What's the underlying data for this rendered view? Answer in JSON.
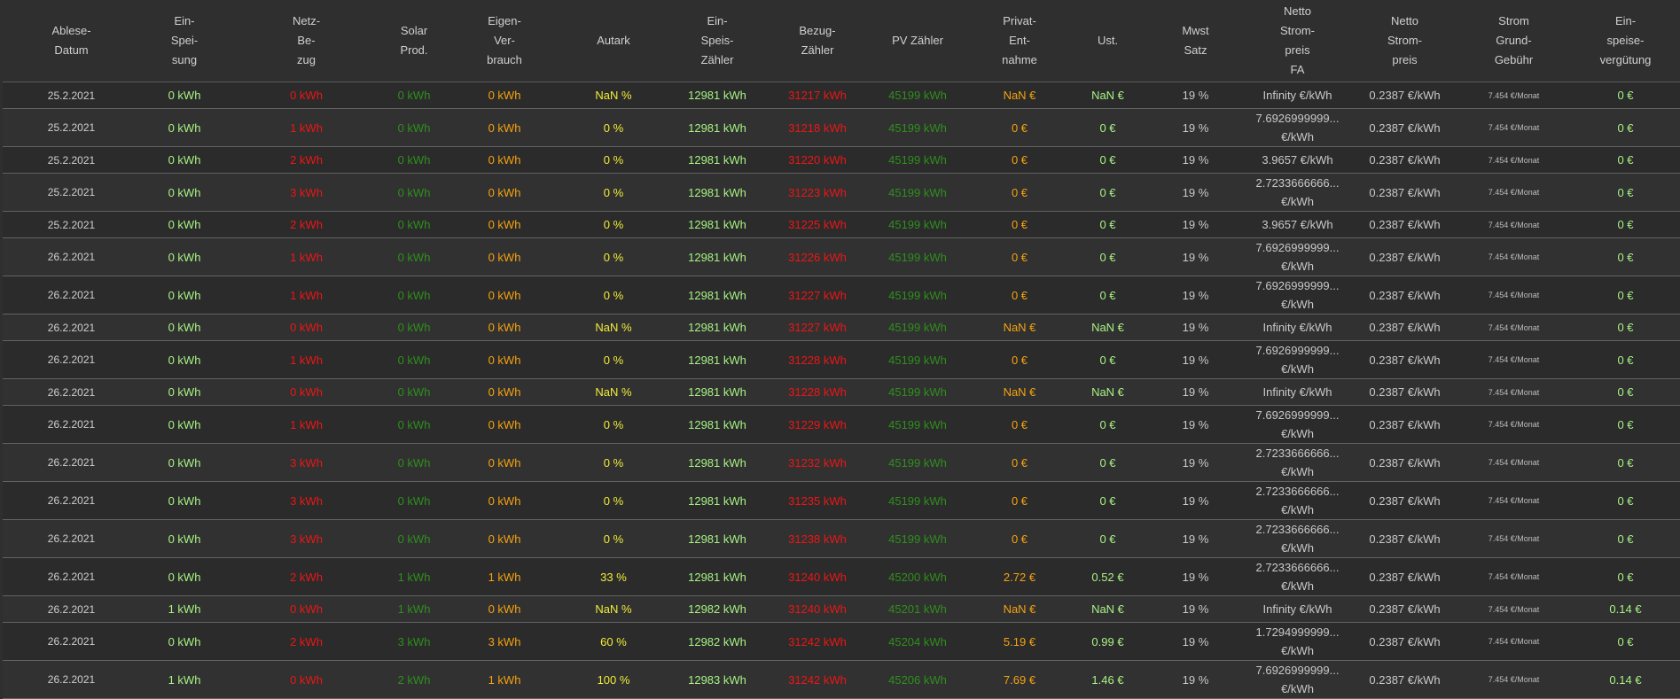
{
  "headers": [
    {
      "key": "datum",
      "label": "Ablese-\nDatum"
    },
    {
      "key": "einspeisung",
      "label": "Ein-\nSpei-\nsung"
    },
    {
      "key": "netzbezug",
      "label": "Netz-\nBe-\nzug"
    },
    {
      "key": "solar",
      "label": "Solar\nProd."
    },
    {
      "key": "eigen",
      "label": "Eigen-\nVer-\nbrauch"
    },
    {
      "key": "autark",
      "label": "Autark"
    },
    {
      "key": "einspeiszaehler",
      "label": "Ein-\nSpeis-\nZähler"
    },
    {
      "key": "bezugzaehler",
      "label": "Bezug-\nZähler"
    },
    {
      "key": "pvzaehler",
      "label": "PV Zähler"
    },
    {
      "key": "privat",
      "label": "Privat-\nEnt-\nnahme"
    },
    {
      "key": "ust",
      "label": "Ust."
    },
    {
      "key": "mwst",
      "label": "Mwst\nSatz"
    },
    {
      "key": "nettofa",
      "label": "Netto\nStrom-\npreis\nFA"
    },
    {
      "key": "netto",
      "label": "Netto\nStrom-\npreis"
    },
    {
      "key": "grund",
      "label": "Strom\nGrund-\nGebühr"
    },
    {
      "key": "verguetung",
      "label": "Ein-\nspeise-\nvergütung"
    }
  ],
  "rows": [
    {
      "datum": "25.2.2021",
      "einspeisung": "0 kWh",
      "netzbezug": "0 kWh",
      "solar": "0 kWh",
      "eigen": "0 kWh",
      "autark": "NaN %",
      "einspeiszaehler": "12981 kWh",
      "bezugzaehler": "31217 kWh",
      "pvzaehler": "45199 kWh",
      "privat": "NaN €",
      "ust": "NaN €",
      "mwst": "19 %",
      "nettofa": "Infinity €/kWh",
      "netto": "0.2387 €/kWh",
      "grund": "7.454 €/Monat",
      "verguetung": "0 €"
    },
    {
      "datum": "25.2.2021",
      "einspeisung": "0 kWh",
      "netzbezug": "1 kWh",
      "solar": "0 kWh",
      "eigen": "0 kWh",
      "autark": "0 %",
      "einspeiszaehler": "12981 kWh",
      "bezugzaehler": "31218 kWh",
      "pvzaehler": "45199 kWh",
      "privat": "0 €",
      "ust": "0 €",
      "mwst": "19 %",
      "nettofa": "7.6926999999...\n€/kWh",
      "netto": "0.2387 €/kWh",
      "grund": "7.454 €/Monat",
      "verguetung": "0 €"
    },
    {
      "datum": "25.2.2021",
      "einspeisung": "0 kWh",
      "netzbezug": "2 kWh",
      "solar": "0 kWh",
      "eigen": "0 kWh",
      "autark": "0 %",
      "einspeiszaehler": "12981 kWh",
      "bezugzaehler": "31220 kWh",
      "pvzaehler": "45199 kWh",
      "privat": "0 €",
      "ust": "0 €",
      "mwst": "19 %",
      "nettofa": "3.9657 €/kWh",
      "netto": "0.2387 €/kWh",
      "grund": "7.454 €/Monat",
      "verguetung": "0 €"
    },
    {
      "datum": "25.2.2021",
      "einspeisung": "0 kWh",
      "netzbezug": "3 kWh",
      "solar": "0 kWh",
      "eigen": "0 kWh",
      "autark": "0 %",
      "einspeiszaehler": "12981 kWh",
      "bezugzaehler": "31223 kWh",
      "pvzaehler": "45199 kWh",
      "privat": "0 €",
      "ust": "0 €",
      "mwst": "19 %",
      "nettofa": "2.7233666666...\n€/kWh",
      "netto": "0.2387 €/kWh",
      "grund": "7.454 €/Monat",
      "verguetung": "0 €"
    },
    {
      "datum": "25.2.2021",
      "einspeisung": "0 kWh",
      "netzbezug": "2 kWh",
      "solar": "0 kWh",
      "eigen": "0 kWh",
      "autark": "0 %",
      "einspeiszaehler": "12981 kWh",
      "bezugzaehler": "31225 kWh",
      "pvzaehler": "45199 kWh",
      "privat": "0 €",
      "ust": "0 €",
      "mwst": "19 %",
      "nettofa": "3.9657 €/kWh",
      "netto": "0.2387 €/kWh",
      "grund": "7.454 €/Monat",
      "verguetung": "0 €"
    },
    {
      "datum": "26.2.2021",
      "einspeisung": "0 kWh",
      "netzbezug": "1 kWh",
      "solar": "0 kWh",
      "eigen": "0 kWh",
      "autark": "0 %",
      "einspeiszaehler": "12981 kWh",
      "bezugzaehler": "31226 kWh",
      "pvzaehler": "45199 kWh",
      "privat": "0 €",
      "ust": "0 €",
      "mwst": "19 %",
      "nettofa": "7.6926999999...\n€/kWh",
      "netto": "0.2387 €/kWh",
      "grund": "7.454 €/Monat",
      "verguetung": "0 €"
    },
    {
      "datum": "26.2.2021",
      "einspeisung": "0 kWh",
      "netzbezug": "1 kWh",
      "solar": "0 kWh",
      "eigen": "0 kWh",
      "autark": "0 %",
      "einspeiszaehler": "12981 kWh",
      "bezugzaehler": "31227 kWh",
      "pvzaehler": "45199 kWh",
      "privat": "0 €",
      "ust": "0 €",
      "mwst": "19 %",
      "nettofa": "7.6926999999...\n€/kWh",
      "netto": "0.2387 €/kWh",
      "grund": "7.454 €/Monat",
      "verguetung": "0 €"
    },
    {
      "datum": "26.2.2021",
      "einspeisung": "0 kWh",
      "netzbezug": "0 kWh",
      "solar": "0 kWh",
      "eigen": "0 kWh",
      "autark": "NaN %",
      "einspeiszaehler": "12981 kWh",
      "bezugzaehler": "31227 kWh",
      "pvzaehler": "45199 kWh",
      "privat": "NaN €",
      "ust": "NaN €",
      "mwst": "19 %",
      "nettofa": "Infinity €/kWh",
      "netto": "0.2387 €/kWh",
      "grund": "7.454 €/Monat",
      "verguetung": "0 €"
    },
    {
      "datum": "26.2.2021",
      "einspeisung": "0 kWh",
      "netzbezug": "1 kWh",
      "solar": "0 kWh",
      "eigen": "0 kWh",
      "autark": "0 %",
      "einspeiszaehler": "12981 kWh",
      "bezugzaehler": "31228 kWh",
      "pvzaehler": "45199 kWh",
      "privat": "0 €",
      "ust": "0 €",
      "mwst": "19 %",
      "nettofa": "7.6926999999...\n€/kWh",
      "netto": "0.2387 €/kWh",
      "grund": "7.454 €/Monat",
      "verguetung": "0 €"
    },
    {
      "datum": "26.2.2021",
      "einspeisung": "0 kWh",
      "netzbezug": "0 kWh",
      "solar": "0 kWh",
      "eigen": "0 kWh",
      "autark": "NaN %",
      "einspeiszaehler": "12981 kWh",
      "bezugzaehler": "31228 kWh",
      "pvzaehler": "45199 kWh",
      "privat": "NaN €",
      "ust": "NaN €",
      "mwst": "19 %",
      "nettofa": "Infinity €/kWh",
      "netto": "0.2387 €/kWh",
      "grund": "7.454 €/Monat",
      "verguetung": "0 €"
    },
    {
      "datum": "26.2.2021",
      "einspeisung": "0 kWh",
      "netzbezug": "1 kWh",
      "solar": "0 kWh",
      "eigen": "0 kWh",
      "autark": "0 %",
      "einspeiszaehler": "12981 kWh",
      "bezugzaehler": "31229 kWh",
      "pvzaehler": "45199 kWh",
      "privat": "0 €",
      "ust": "0 €",
      "mwst": "19 %",
      "nettofa": "7.6926999999...\n€/kWh",
      "netto": "0.2387 €/kWh",
      "grund": "7.454 €/Monat",
      "verguetung": "0 €"
    },
    {
      "datum": "26.2.2021",
      "einspeisung": "0 kWh",
      "netzbezug": "3 kWh",
      "solar": "0 kWh",
      "eigen": "0 kWh",
      "autark": "0 %",
      "einspeiszaehler": "12981 kWh",
      "bezugzaehler": "31232 kWh",
      "pvzaehler": "45199 kWh",
      "privat": "0 €",
      "ust": "0 €",
      "mwst": "19 %",
      "nettofa": "2.7233666666...\n€/kWh",
      "netto": "0.2387 €/kWh",
      "grund": "7.454 €/Monat",
      "verguetung": "0 €"
    },
    {
      "datum": "26.2.2021",
      "einspeisung": "0 kWh",
      "netzbezug": "3 kWh",
      "solar": "0 kWh",
      "eigen": "0 kWh",
      "autark": "0 %",
      "einspeiszaehler": "12981 kWh",
      "bezugzaehler": "31235 kWh",
      "pvzaehler": "45199 kWh",
      "privat": "0 €",
      "ust": "0 €",
      "mwst": "19 %",
      "nettofa": "2.7233666666...\n€/kWh",
      "netto": "0.2387 €/kWh",
      "grund": "7.454 €/Monat",
      "verguetung": "0 €"
    },
    {
      "datum": "26.2.2021",
      "einspeisung": "0 kWh",
      "netzbezug": "3 kWh",
      "solar": "0 kWh",
      "eigen": "0 kWh",
      "autark": "0 %",
      "einspeiszaehler": "12981 kWh",
      "bezugzaehler": "31238 kWh",
      "pvzaehler": "45199 kWh",
      "privat": "0 €",
      "ust": "0 €",
      "mwst": "19 %",
      "nettofa": "2.7233666666...\n€/kWh",
      "netto": "0.2387 €/kWh",
      "grund": "7.454 €/Monat",
      "verguetung": "0 €"
    },
    {
      "datum": "26.2.2021",
      "einspeisung": "0 kWh",
      "netzbezug": "2 kWh",
      "solar": "1 kWh",
      "eigen": "1 kWh",
      "autark": "33 %",
      "einspeiszaehler": "12981 kWh",
      "bezugzaehler": "31240 kWh",
      "pvzaehler": "45200 kWh",
      "privat": "2.72 €",
      "ust": "0.52 €",
      "mwst": "19 %",
      "nettofa": "2.7233666666...\n€/kWh",
      "netto": "0.2387 €/kWh",
      "grund": "7.454 €/Monat",
      "verguetung": "0 €"
    },
    {
      "datum": "26.2.2021",
      "einspeisung": "1 kWh",
      "netzbezug": "0 kWh",
      "solar": "1 kWh",
      "eigen": "0 kWh",
      "autark": "NaN %",
      "einspeiszaehler": "12982 kWh",
      "bezugzaehler": "31240 kWh",
      "pvzaehler": "45201 kWh",
      "privat": "NaN €",
      "ust": "NaN €",
      "mwst": "19 %",
      "nettofa": "Infinity €/kWh",
      "netto": "0.2387 €/kWh",
      "grund": "7.454 €/Monat",
      "verguetung": "0.14 €"
    },
    {
      "datum": "26.2.2021",
      "einspeisung": "0 kWh",
      "netzbezug": "2 kWh",
      "solar": "3 kWh",
      "eigen": "3 kWh",
      "autark": "60 %",
      "einspeiszaehler": "12982 kWh",
      "bezugzaehler": "31242 kWh",
      "pvzaehler": "45204 kWh",
      "privat": "5.19 €",
      "ust": "0.99 €",
      "mwst": "19 %",
      "nettofa": "1.7294999999...\n€/kWh",
      "netto": "0.2387 €/kWh",
      "grund": "7.454 €/Monat",
      "verguetung": "0 €"
    },
    {
      "datum": "26.2.2021",
      "einspeisung": "1 kWh",
      "netzbezug": "0 kWh",
      "solar": "2 kWh",
      "eigen": "1 kWh",
      "autark": "100 %",
      "einspeiszaehler": "12983 kWh",
      "bezugzaehler": "31242 kWh",
      "pvzaehler": "45206 kWh",
      "privat": "7.69 €",
      "ust": "1.46 €",
      "mwst": "19 %",
      "nettofa": "7.6926999999...\n€/kWh",
      "netto": "0.2387 €/kWh",
      "grund": "7.454 €/Monat",
      "verguetung": "0.14 €"
    }
  ]
}
